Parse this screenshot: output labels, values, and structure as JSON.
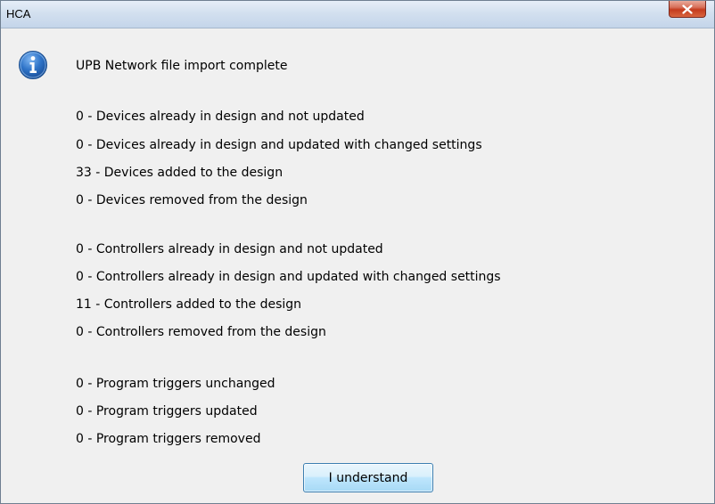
{
  "window": {
    "title": "HCA",
    "close_icon": "close-x-icon"
  },
  "dialog": {
    "icon": "info-icon",
    "heading": "UPB Network file import complete",
    "devices": [
      "0 - Devices already in design and not updated",
      "0 - Devices already in design and updated with changed settings",
      "33 - Devices added to the design",
      "0 - Devices removed from the design"
    ],
    "controllers": [
      "0 - Controllers already in design and not updated",
      "0 - Controllers already in design and updated with changed settings",
      "11 - Controllers added to the design",
      "0 - Controllers removed from the design"
    ],
    "programs": [
      "0 - Program triggers unchanged",
      "0 - Program triggers updated",
      "0 - Program triggers removed"
    ],
    "button_label": "I understand"
  }
}
